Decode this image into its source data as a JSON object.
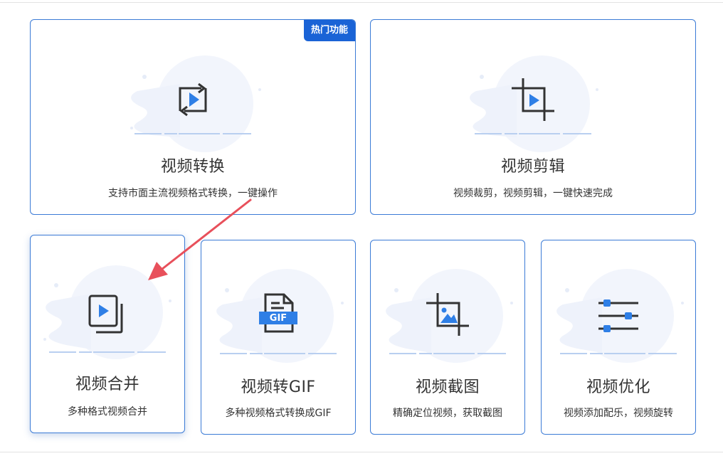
{
  "cards": [
    {
      "title": "视频转换",
      "desc": "支持市面主流视频格式转换，一键操作",
      "badge": "热门功能",
      "icon": "convert-icon"
    },
    {
      "title": "视频剪辑",
      "desc": "视频裁剪，视频剪辑，一键快速完成",
      "icon": "crop-icon"
    },
    {
      "title": "视频合并",
      "desc": "多种格式视频合并",
      "icon": "merge-icon"
    },
    {
      "title": "视频转GIF",
      "desc": "多种视频格式转换成GIF",
      "icon": "gif-file-icon",
      "icon_text": "GIF"
    },
    {
      "title": "视频截图",
      "desc": "精确定位视频，获取截图",
      "icon": "screenshot-crop-icon"
    },
    {
      "title": "视频优化",
      "desc": "视频添加配乐，视频旋转",
      "icon": "sliders-icon"
    }
  ],
  "colors": {
    "accent": "#3b7bd6",
    "badge": "#1a63d6",
    "play": "#2f7fe6",
    "arrow": "#e8505b"
  }
}
